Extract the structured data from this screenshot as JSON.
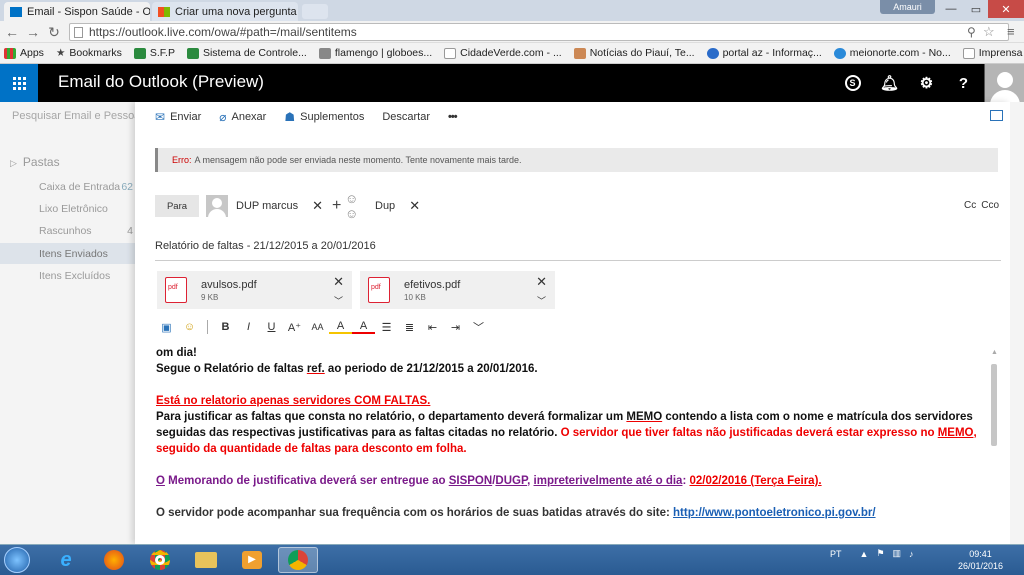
{
  "browser": {
    "tabs": [
      {
        "title": "Email - Sispon Saúde - Ou",
        "icon": "outlook-mail-icon",
        "active": true
      },
      {
        "title": "Criar uma nova pergunta o",
        "icon": "microsoft-icon",
        "active": false
      }
    ],
    "window_user": "Amauri",
    "url": "https://outlook.live.com/owa/#path=/mail/sentitems",
    "bookmarks": [
      {
        "label": "Apps",
        "icon": "apps-grid-icon"
      },
      {
        "label": "Bookmarks",
        "icon": "star-icon"
      },
      {
        "label": "S.F.P",
        "icon": "ati-icon"
      },
      {
        "label": "Sistema de Controle...",
        "icon": "ati-icon"
      },
      {
        "label": "flamengo | globoes...",
        "icon": "globo-icon"
      },
      {
        "label": "CidadeVerde.com - ...",
        "icon": "page-icon"
      },
      {
        "label": "Notícias do Piauí, Te...",
        "icon": "news-icon"
      },
      {
        "label": "portal az - Informaç...",
        "icon": "portal-icon"
      },
      {
        "label": "meionorte.com - No...",
        "icon": "meionorte-icon"
      },
      {
        "label": "Imprensa Nacional -...",
        "icon": "page-icon"
      }
    ]
  },
  "header": {
    "app_title": "Email do Outlook (Preview)"
  },
  "sidebar": {
    "search_placeholder": "Pesquisar Email e Pessoas",
    "section_label": "Pastas",
    "folders": [
      {
        "label": "Caixa de Entrada",
        "count": "62"
      },
      {
        "label": "Lixo Eletrônico",
        "count": ""
      },
      {
        "label": "Rascunhos",
        "count": "4"
      },
      {
        "label": "Itens Enviados",
        "count": ""
      },
      {
        "label": "Itens Excluídos",
        "count": ""
      }
    ]
  },
  "toolbar": {
    "send": "Enviar",
    "attach": "Anexar",
    "addins": "Suplementos",
    "discard": "Descartar",
    "more": "•••"
  },
  "error": {
    "label": "Erro:",
    "message": "A mensagem não pode ser enviada neste momento. Tente novamente mais tarde."
  },
  "recipients": {
    "to_label": "Para",
    "people": [
      "DUP marcus",
      "Dup"
    ],
    "cc": "Cc",
    "bcc": "Cco"
  },
  "subject": "Relatório de faltas - 21/12/2015 a 20/01/2016",
  "attachments": [
    {
      "name": "avulsos.pdf",
      "size": "9 KB"
    },
    {
      "name": "efetivos.pdf",
      "size": "10 KB"
    }
  ],
  "body": {
    "line1": "om dia!",
    "line2a": "Segue o Relatório de faltas ",
    "line2b": "ref.",
    "line2c": " ao periodo de 21/12/2015 a 20/01/2016.",
    "line3": "Está no relatorio apenas servidores COM FALTAS.",
    "line4a": "Para justificar as faltas que consta no relatório, o departamento deverá formalizar um ",
    "line4b": "MEMO",
    "line4c": " contendo a lista com o nome e matrícula dos servidores seguidas das respectivas justificativas para as faltas citadas no relatório. ",
    "line4d": "O servidor que tiver faltas não justificadas deverá estar expresso no ",
    "line4e": "MEMO",
    "line4f": ", seguido da quantidade de faltas para desconto em folha.",
    "line5a": "O",
    "line5b": " Memorando de justificativa deverá ser entregue ao ",
    "line5c": "SISPON",
    "line5d": "/",
    "line5e": "DUGP",
    "line5f": ", ",
    "line5g": "impreterivelmente até o dia",
    "line5h": ": ",
    "line5i": "02/02/2016 (Terça Feira).",
    "line6a": "O servidor pode acompanhar sua frequência com os horários de suas batidas através do site: ",
    "line6b": "http://www.pontoeletronico.pi.gov.br/"
  },
  "taskbar": {
    "lang": "PT",
    "time": "09:41",
    "date": "26/01/2016"
  }
}
